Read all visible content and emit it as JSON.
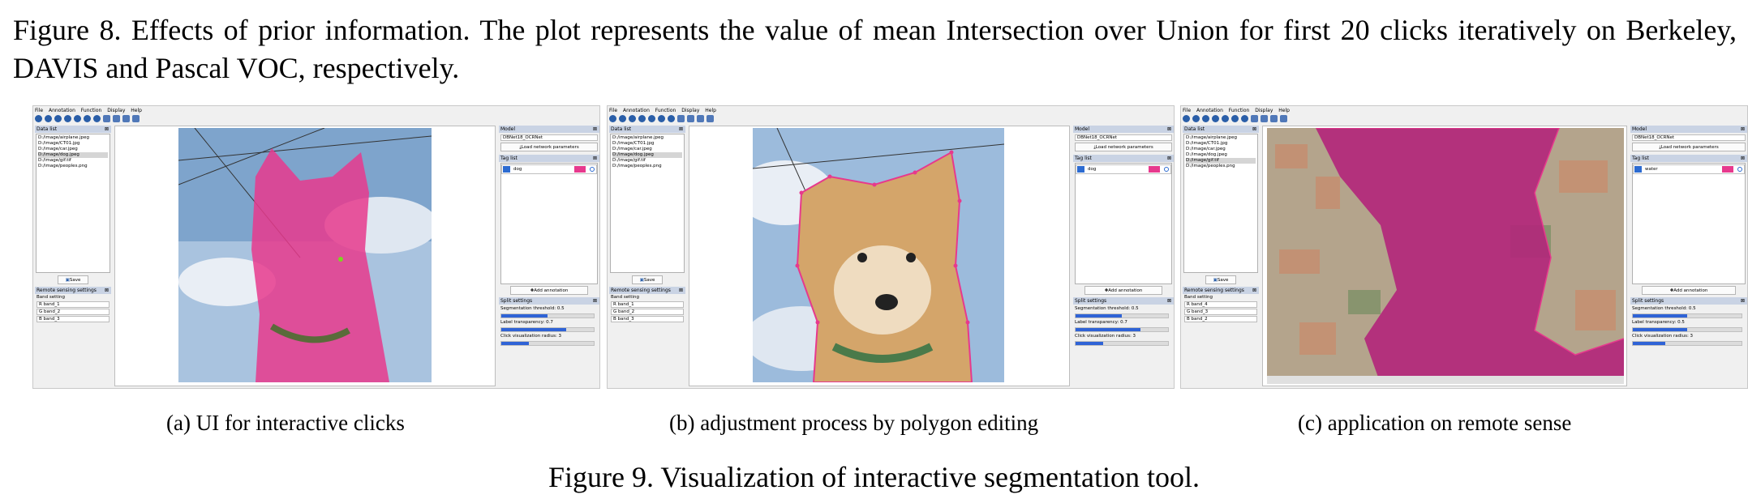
{
  "top_caption": "Figure 8. Effects of prior information. The plot represents the value of mean Intersection over Union for first 20 clicks iteratively on Berkeley, DAVIS and Pascal VOC, respectively.",
  "bottom_caption": "Figure 9. Visualization of interactive segmentation tool.",
  "colors": {
    "mask_pink": "#e7398d",
    "dock_title_bg": "#c9d3e4",
    "tag_blue": "#2c6bd1",
    "slider_blue": "#2f63d6",
    "click_point_green": "#7ed321"
  },
  "panels": [
    {
      "subcaption": "(a) UI for interactive clicks",
      "menu": [
        "File",
        "Annotation",
        "Function",
        "Display",
        "Help"
      ],
      "data_list_title": "Data list",
      "files": [
        "D:/image/airplane.jpeg",
        "D:/image/CT01.jpg",
        "D:/image/car.jpeg",
        "D:/image/dog.jpeg",
        "D:/image/gif.tif",
        "D:/image/peoples.png"
      ],
      "selected_file_index": 3,
      "save_label": "Save",
      "remote_title": "Remote sensing settings",
      "band_setting_label": "Band setting",
      "bands": [
        "R  band_1",
        "G  band_2",
        "B  band_3"
      ],
      "model_title": "Model",
      "model_value": "DBNet18_OCRNet",
      "load_params_label": "Load network parameters",
      "tag_list_title": "Tag list",
      "tag_name": "dog",
      "add_annotation_label": "Add annotation",
      "split_title": "Split settings",
      "threshold_label": "Segmentation threshold: 0.5",
      "threshold_value": 0.5,
      "transparency_label": "Label transparency: 0.7",
      "transparency_value": 0.7,
      "radius_label": "Click visualization radius: 3",
      "radius_value": 0.3,
      "scene": "dog-mask"
    },
    {
      "subcaption": "(b) adjustment process by polygon editing",
      "menu": [
        "File",
        "Annotation",
        "Function",
        "Display",
        "Help"
      ],
      "data_list_title": "Data list",
      "files": [
        "D:/image/airplane.jpeg",
        "D:/image/CT01.jpg",
        "D:/image/car.jpeg",
        "D:/image/dog.jpeg",
        "D:/image/gif.tif",
        "D:/image/peoples.png"
      ],
      "selected_file_index": 3,
      "save_label": "Save",
      "remote_title": "Remote sensing settings",
      "band_setting_label": "Band setting",
      "bands": [
        "R  band_1",
        "G  band_2",
        "B  band_3"
      ],
      "model_title": "Model",
      "model_value": "DBNet18_OCRNet",
      "load_params_label": "Load network parameters",
      "tag_list_title": "Tag list",
      "tag_name": "dog",
      "add_annotation_label": "Add annotation",
      "split_title": "Split settings",
      "threshold_label": "Segmentation threshold: 0.5",
      "threshold_value": 0.5,
      "transparency_label": "Label transparency: 0.7",
      "transparency_value": 0.7,
      "radius_label": "Click visualization radius: 3",
      "radius_value": 0.3,
      "scene": "dog-polygon"
    },
    {
      "subcaption": "(c) application on remote sense",
      "menu": [
        "File",
        "Annotation",
        "Function",
        "Display",
        "Help"
      ],
      "data_list_title": "Data list",
      "files": [
        "D:/image/airplane.jpeg",
        "D:/image/CT01.jpg",
        "D:/image/car.jpeg",
        "D:/image/dog.jpeg",
        "D:/image/gif.tif",
        "D:/image/peoples.png"
      ],
      "selected_file_index": 4,
      "save_label": "Save",
      "remote_title": "Remote sensing settings",
      "band_setting_label": "Band setting",
      "bands": [
        "R  band_4",
        "G  band_3",
        "B  band_2"
      ],
      "model_title": "Model",
      "model_value": "DBNet18_OCRNet",
      "load_params_label": "Load network parameters",
      "tag_list_title": "Tag list",
      "tag_name": "water",
      "add_annotation_label": "Add annotation",
      "split_title": "Split settings",
      "threshold_label": "Segmentation threshold: 0.5",
      "threshold_value": 0.5,
      "transparency_label": "Label transparency: 0.5",
      "transparency_value": 0.5,
      "radius_label": "Click visualization radius: 3",
      "radius_value": 0.3,
      "scene": "remote"
    }
  ]
}
